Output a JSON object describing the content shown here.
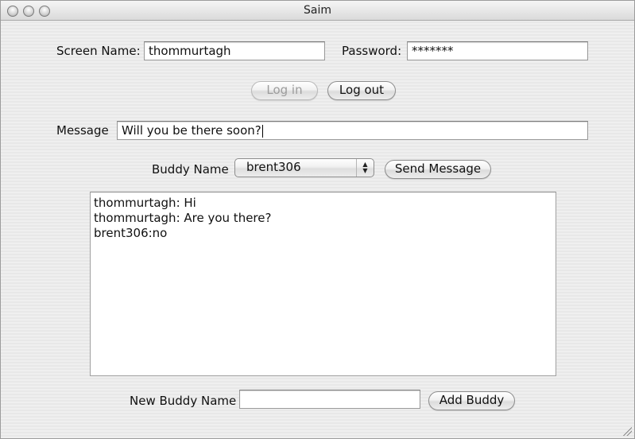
{
  "window": {
    "title": "Saim"
  },
  "login": {
    "screen_name_label": "Screen Name:",
    "screen_name_value": "thommurtagh",
    "password_label": "Password:",
    "password_value": "*******",
    "login_button": "Log in",
    "login_enabled": false,
    "logout_button": "Log out"
  },
  "message": {
    "label": "Message",
    "value": "Will you be there soon?"
  },
  "buddy": {
    "label": "Buddy Name",
    "selected": "brent306",
    "send_button": "Send Message"
  },
  "chat": {
    "lines": [
      "thommurtagh: Hi",
      "thommurtagh: Are you there?",
      "brent306:no"
    ]
  },
  "add_buddy": {
    "label": "New Buddy Name",
    "value": "",
    "button": "Add Buddy"
  },
  "icons": {
    "close": "close-icon",
    "minimize": "minimize-icon",
    "zoom": "zoom-icon",
    "popup_arrows": "updown-arrows-icon",
    "resize": "resize-grip-icon"
  }
}
